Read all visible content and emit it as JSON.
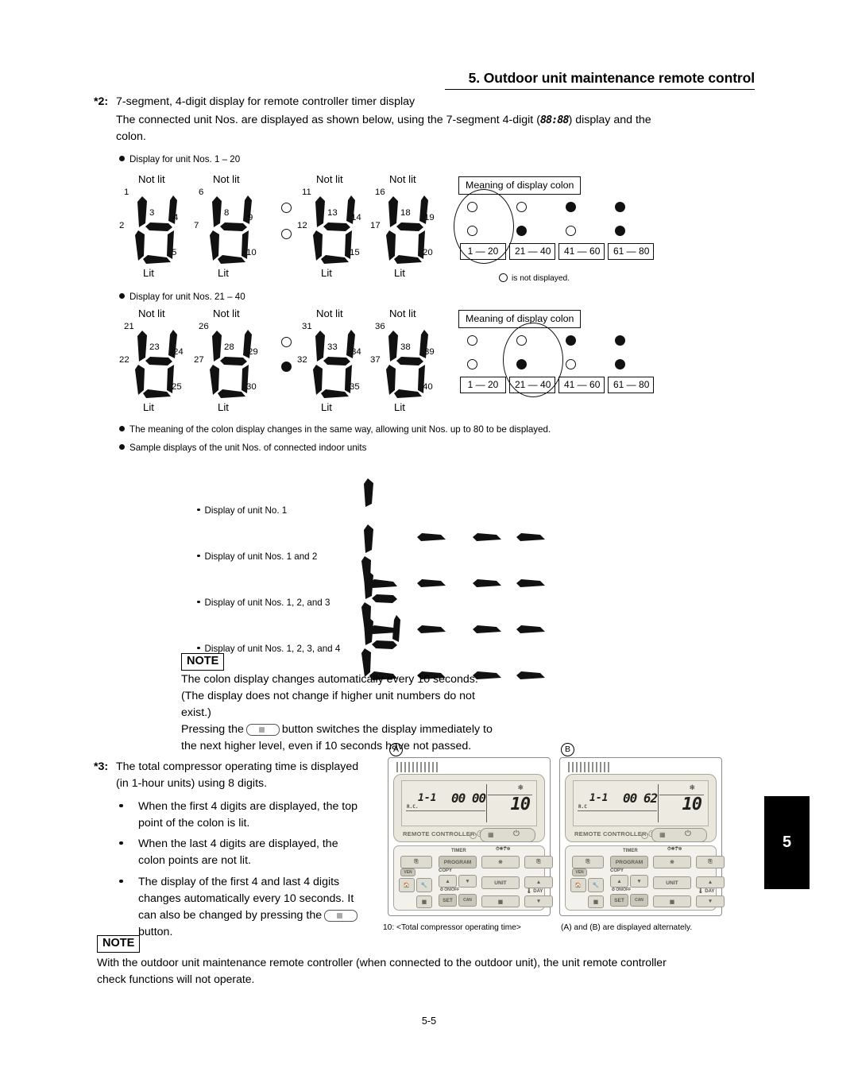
{
  "header": {
    "title": "5. Outdoor unit maintenance remote control"
  },
  "note2": {
    "marker": "*2:",
    "line1": "7-segment, 4-digit display for remote controller timer display",
    "line2_a": "The connected unit Nos. are displayed as shown below, using the 7-segment 4-digit (",
    "line2_seg": "88:88",
    "line2_b": ") display and the",
    "line3": "colon."
  },
  "group1": {
    "bullet_label": "Display for unit Nos. 1 – 20",
    "not_lit": "Not lit",
    "lit": "Lit",
    "digits": [
      {
        "labels": [
          "1",
          "2",
          "3",
          "4",
          "5"
        ]
      },
      {
        "labels": [
          "6",
          "7",
          "8",
          "9",
          "10"
        ]
      },
      {
        "labels": [
          "11",
          "12",
          "13",
          "14",
          "15"
        ]
      },
      {
        "labels": [
          "16",
          "17",
          "18",
          "19",
          "20"
        ]
      }
    ],
    "colon": {
      "top": "open",
      "bottom": "open"
    }
  },
  "group2": {
    "bullet_label": "Display for unit Nos. 21 – 40",
    "not_lit": "Not lit",
    "lit": "Lit",
    "digits": [
      {
        "labels": [
          "21",
          "22",
          "23",
          "24",
          "25"
        ]
      },
      {
        "labels": [
          "26",
          "27",
          "28",
          "29",
          "30"
        ]
      },
      {
        "labels": [
          "31",
          "32",
          "33",
          "34",
          "35"
        ]
      },
      {
        "labels": [
          "36",
          "37",
          "38",
          "39",
          "40"
        ]
      }
    ],
    "colon": {
      "top": "open",
      "bottom": "filled"
    }
  },
  "colon_table": {
    "title": "Meaning of display colon",
    "footnote": "is not displayed.",
    "columns": [
      {
        "range": "1 — 20",
        "top": "open",
        "bottom": "open"
      },
      {
        "range": "21 — 40",
        "top": "open",
        "bottom": "filled"
      },
      {
        "range": "41 — 60",
        "top": "filled",
        "bottom": "open"
      },
      {
        "range": "61 — 80",
        "top": "filled",
        "bottom": "filled"
      }
    ],
    "highlight_group1": 0,
    "highlight_group2": 1
  },
  "bullets": {
    "b1": "The meaning of the colon display changes in the same way, allowing unit Nos. up to 80 to be displayed.",
    "b2": "Sample displays of the unit Nos. of connected indoor units"
  },
  "samples": [
    {
      "label": "Display of unit No. 1",
      "pattern": "1"
    },
    {
      "label": "Display of unit Nos. 1 and 2",
      "pattern": "12"
    },
    {
      "label": "Display of unit Nos. 1, 2, and 3",
      "pattern": "123"
    },
    {
      "label": "Display of unit Nos. 1, 2, 3, and 4",
      "pattern": "1234"
    }
  ],
  "note_box_1": {
    "label": "NOTE",
    "line1": "The colon display changes automatically every 10 seconds.",
    "line2": "(The display does not change if higher unit numbers do not",
    "line3": "exist.)",
    "line4_a": "Pressing the",
    "line4_b": "button switches the display immediately to",
    "line5": "the next higher level, even if 10 seconds have not passed."
  },
  "note3": {
    "marker": "*3:",
    "intro1": "The total compressor operating time is displayed",
    "intro2": "in 1-hour units) using 8 digits.",
    "intro2_prefix": "(",
    "items": [
      {
        "l1": "When the first 4 digits are displayed, the top",
        "l2": "point of the colon is lit."
      },
      {
        "l1": "When the last 4 digits are displayed, the",
        "l2": "colon points are not lit."
      },
      {
        "l1": "The display of the first 4 and last 4 digits",
        "l2": "changes automatically every 10 seconds. It",
        "l3_a": "can also be changed by pressing the",
        "l4": "button."
      }
    ]
  },
  "remotes": {
    "panel_a": {
      "letter": "A",
      "lcd_unit": "1-1",
      "lcd_rc": "R.C.",
      "lcd_time": "00 00",
      "lcd_right": "10",
      "brand": "REMOTE CONTROLLER-ⓘ"
    },
    "panel_b": {
      "letter": "B",
      "lcd_unit": "1-1",
      "lcd_rc": "R.C",
      "lcd_time": "00 62",
      "lcd_right": "10",
      "brand": "REMOTE CONTROLLER-ⓘ"
    },
    "keys": {
      "timer": "TIMER",
      "program": "PROGRAM",
      "copy": "COPY",
      "set": "SET",
      "can": "CAN",
      "unit": "UNIT",
      "onoff": "ON/OFF",
      "day": "DAY"
    },
    "caption_left": "10: <Total compressor operating time>",
    "caption_right": "(A) and (B) are displayed alternately."
  },
  "note_box_2": {
    "label": "NOTE",
    "line1": "With the outdoor unit maintenance remote controller (when connected to the outdoor unit), the unit remote controller",
    "line2": "check functions will not operate."
  },
  "page_tab": "5",
  "footer": "5-5"
}
